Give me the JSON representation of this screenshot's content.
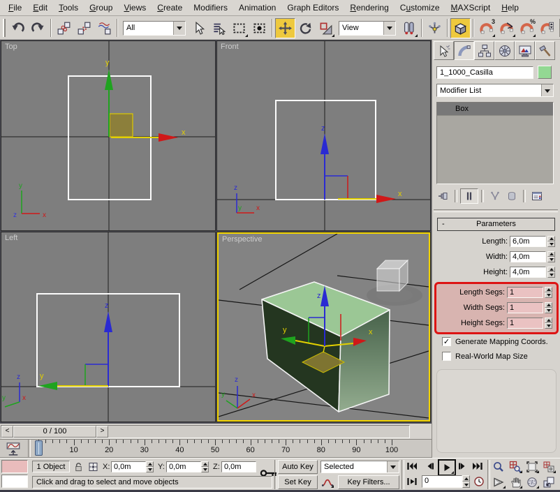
{
  "menu_bar": {
    "items": [
      {
        "label": "File",
        "underline": 0
      },
      {
        "label": "Edit",
        "underline": 0
      },
      {
        "label": "Tools",
        "underline": 0
      },
      {
        "label": "Group",
        "underline": 0
      },
      {
        "label": "Views",
        "underline": 0
      },
      {
        "label": "Create",
        "underline": 0
      },
      {
        "label": "Modifiers",
        "underline": -1
      },
      {
        "label": "Animation",
        "underline": -1
      },
      {
        "label": "Graph Editors",
        "underline": -1
      },
      {
        "label": "Rendering",
        "underline": 0
      },
      {
        "label": "Customize",
        "underline": 1
      },
      {
        "label": "MAXScript",
        "underline": 0
      },
      {
        "label": "Help",
        "underline": 0
      }
    ]
  },
  "toolbar": {
    "selection_filter_value": "All",
    "reference_coordinate_value": "View",
    "items": [
      {
        "t": "grip"
      },
      {
        "t": "btn",
        "name": "undo-button",
        "icon": "undo"
      },
      {
        "t": "btn",
        "name": "redo-button",
        "icon": "redo"
      },
      {
        "t": "sep"
      },
      {
        "t": "btn",
        "name": "select-and-link-button",
        "icon": "link"
      },
      {
        "t": "btn",
        "name": "unlink-selection-button",
        "icon": "unlink"
      },
      {
        "t": "btn",
        "name": "bind-to-space-warp-button",
        "icon": "spacewarp"
      },
      {
        "t": "sep"
      },
      {
        "t": "dd",
        "name": "selection-filter-dropdown",
        "bind": "toolbar.selection_filter_value",
        "w": 90
      },
      {
        "t": "btn",
        "name": "select-object-button",
        "icon": "select"
      },
      {
        "t": "btn",
        "name": "select-by-name-button",
        "icon": "selectbyname"
      },
      {
        "t": "btn",
        "name": "rectangular-selection-region-button",
        "icon": "region",
        "fly": true
      },
      {
        "t": "btn",
        "name": "window-crossing-toggle-button",
        "icon": "crossing"
      },
      {
        "t": "sep"
      },
      {
        "t": "btn",
        "name": "select-and-move-button",
        "icon": "move",
        "active": true
      },
      {
        "t": "btn",
        "name": "select-and-rotate-button",
        "icon": "rotate"
      },
      {
        "t": "btn",
        "name": "select-and-uniform-scale-button",
        "icon": "scale",
        "fly": true
      },
      {
        "t": "dd",
        "name": "reference-coordinate-system-dropdown",
        "bind": "toolbar.reference_coordinate_value",
        "w": 82
      },
      {
        "t": "btn",
        "name": "use-pivot-point-center-button",
        "icon": "pivot",
        "fly": true
      },
      {
        "t": "sep"
      },
      {
        "t": "btn",
        "name": "select-and-manipulate-button",
        "icon": "manipulate"
      },
      {
        "t": "sep"
      },
      {
        "t": "btn",
        "name": "snaps-toggle-button",
        "icon": "snapcube",
        "active": true
      },
      {
        "t": "sep"
      },
      {
        "t": "btn",
        "name": "snap-3d-button",
        "icon": "magnet",
        "overlay": "3",
        "fly": true
      },
      {
        "t": "btn",
        "name": "angle-snap-toggle-button",
        "icon": "magnetangle",
        "fly": true
      },
      {
        "t": "btn",
        "name": "percent-snap-toggle-button",
        "icon": "magnet",
        "overlay": "%",
        "fly": true
      },
      {
        "t": "btn",
        "name": "spinner-snap-toggle-button",
        "icon": "magnetspin"
      },
      {
        "t": "sep"
      }
    ]
  },
  "viewports": {
    "top_label": "Top",
    "front_label": "Front",
    "left_label": "Left",
    "perspective_label": "Perspective",
    "active_viewport": "Perspective",
    "active_border_color": "#f2d400",
    "axis_labels": {
      "x": "x",
      "y": "y",
      "z": "z"
    }
  },
  "time_slider": {
    "value": "0 / 100",
    "prev_glyph": "<",
    "next_glyph": ">"
  },
  "track_bar": {
    "min": 0,
    "max": 100,
    "label_step": 10,
    "minor_step": 2,
    "current_frame": 0
  },
  "command_panel": {
    "tabs": [
      {
        "name": "create",
        "icon": "tabcreate",
        "active": false
      },
      {
        "name": "modify",
        "icon": "tabmodify",
        "active": true
      },
      {
        "name": "hierarchy",
        "icon": "tabhierarchy",
        "active": false
      },
      {
        "name": "motion",
        "icon": "tabmotion",
        "active": false
      },
      {
        "name": "display",
        "icon": "tabdisplay",
        "active": false
      },
      {
        "name": "utilities",
        "icon": "tabutilities",
        "active": false
      }
    ],
    "object_name": "1_1000_Casilla",
    "object_color": "#93d893",
    "modifier_list_label": "Modifier List",
    "modifier_stack": [
      {
        "name": "Box",
        "selected": true
      }
    ],
    "stack_tools": [
      {
        "name": "pin-stack",
        "icon": "pinstack"
      },
      {
        "name": "show-end-result",
        "icon": "showend",
        "pressed": true
      },
      {
        "name": "make-unique",
        "icon": "unique"
      },
      {
        "name": "remove-modifier",
        "icon": "removemod"
      },
      {
        "name": "configure-modifier-sets",
        "icon": "configsets"
      }
    ],
    "parameters": {
      "title": "Parameters",
      "collapse_glyph": "-",
      "dimension_fields": [
        {
          "label": "Length:",
          "value": "6,0m"
        },
        {
          "label": "Width:",
          "value": "4,0m"
        },
        {
          "label": "Height:",
          "value": "4,0m"
        }
      ],
      "segment_fields": [
        {
          "label": "Length Segs:",
          "value": "1"
        },
        {
          "label": "Width Segs:",
          "value": "1"
        },
        {
          "label": "Height Segs:",
          "value": "1"
        }
      ],
      "highlight_color": "#dd1414",
      "check_glyph": "✓",
      "checkboxes": [
        {
          "label": "Generate Mapping Coords.",
          "checked": true
        },
        {
          "label": "Real-World Map Size",
          "checked": false
        }
      ]
    }
  },
  "status_bar": {
    "selection_count": "1 Object",
    "prompt": "Click and drag to select and move objects",
    "coord_labels": {
      "x": "X:",
      "y": "Y:",
      "z": "Z:"
    },
    "coords": {
      "x": "0,0m",
      "y": "0,0m",
      "z": "0,0m"
    },
    "auto_key_label": "Auto Key",
    "set_key_label": "Set Key",
    "key_mode_value": "Selected",
    "key_filters_label": "Key Filters...",
    "current_frame_value": "0",
    "transport_buttons": [
      "go-to-start",
      "previous-frame",
      "play",
      "next-frame",
      "go-to-end"
    ],
    "nav_buttons": [
      "zoom",
      "zoom-all",
      "zoom-extents",
      "zoom-extents-all",
      "field-of-view",
      "pan",
      "arc-rotate",
      "min-max-toggle"
    ]
  }
}
